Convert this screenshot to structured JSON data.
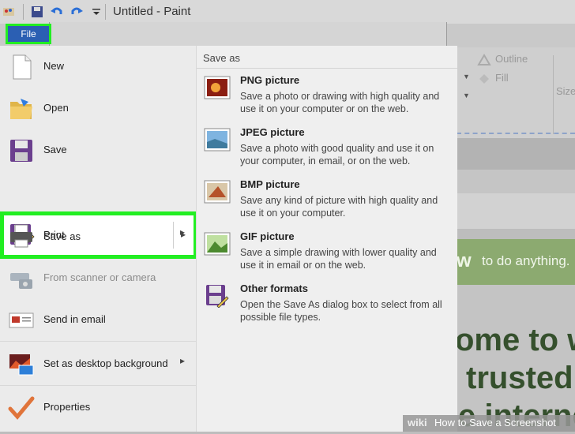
{
  "window": {
    "title": "Untitled - Paint"
  },
  "file_tab": {
    "label": "File"
  },
  "menu": {
    "items": [
      {
        "label": "New"
      },
      {
        "label": "Open"
      },
      {
        "label": "Save"
      },
      {
        "label": "Save as"
      },
      {
        "label": "Print"
      },
      {
        "label": "From scanner or camera"
      },
      {
        "label": "Send in email"
      },
      {
        "label": "Set as desktop background"
      },
      {
        "label": "Properties"
      }
    ]
  },
  "save_as": {
    "header": "Save as",
    "options": [
      {
        "title": "PNG picture",
        "desc": "Save a photo or drawing with high quality and use it on your computer or on the web."
      },
      {
        "title": "JPEG picture",
        "desc": "Save a photo with good quality and use it on your computer, in email, or on the web."
      },
      {
        "title": "BMP picture",
        "desc": "Save any kind of picture with high quality and use it on your computer."
      },
      {
        "title": "GIF picture",
        "desc": "Save a simple drawing with lower quality and use it in email or on the web."
      },
      {
        "title": "Other formats",
        "desc": "Open the Save As dialog box to select from all possible file types."
      }
    ]
  },
  "ribbon": {
    "outline": "Outline",
    "fill": "Fill",
    "size": "Size"
  },
  "background": {
    "green_text_1": "w",
    "green_text_2": "to do anything.",
    "line1": "ome to w",
    "line2": "trusted",
    "line3": "e interne"
  },
  "watermark": {
    "prefix": "wiki",
    "text": "How to Save a Screenshot"
  },
  "colors": {
    "highlight": "#22ee22",
    "file_blue": "#2b5fb3"
  }
}
